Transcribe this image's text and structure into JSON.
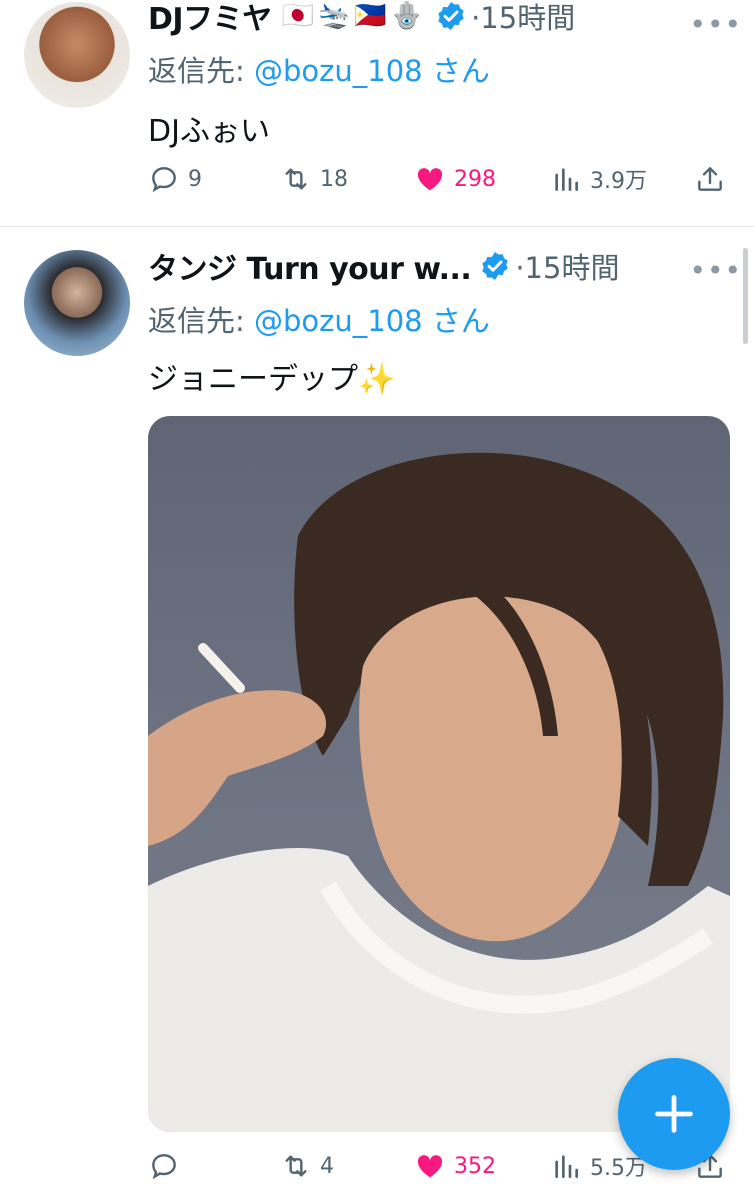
{
  "tweets": [
    {
      "name": "DJフミヤ",
      "flags": "🇯🇵🛬🇵🇭🪬",
      "time": "15時間",
      "reply_prefix": "返信先:",
      "reply_handle": "@bozu_108",
      "reply_suffix": "さん",
      "text": "DJふぉい",
      "replies": "9",
      "retweets": "18",
      "likes": "298",
      "views": "3.9万"
    },
    {
      "name": "タンジ Turn your w...",
      "time": "15時間",
      "reply_prefix": "返信先:",
      "reply_handle": "@bozu_108",
      "reply_suffix": "さん",
      "text": "ジョニーデップ✨",
      "replies": "",
      "retweets": "4",
      "likes": "352",
      "views": "5.5万"
    }
  ],
  "more_label": "•••",
  "colors": {
    "accent": "#1d9bf0",
    "like": "#f91880",
    "muted": "#536471"
  }
}
